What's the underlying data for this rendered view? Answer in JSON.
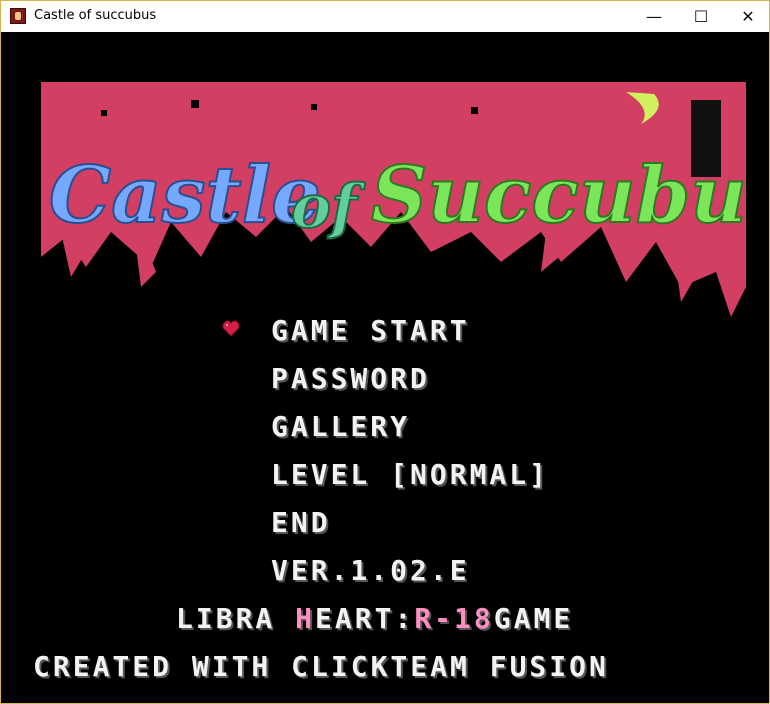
{
  "window": {
    "title": "Castle of succubus",
    "min_glyph": "—",
    "max_glyph": "☐",
    "close_glyph": "✕"
  },
  "logo": {
    "text": "Castle of Succubus"
  },
  "menu": {
    "items": [
      "GAME START",
      "PASSWORD",
      "GALLERY",
      "LEVEL [NORMAL]",
      "END",
      "VER.1.02.E"
    ],
    "selected": "GAME START"
  },
  "footer": {
    "credit_libra": "LIBRA ",
    "credit_h": "H",
    "credit_eart": "EART:",
    "credit_r18": "R-18",
    "credit_game": "GAME",
    "engine": "CREATED WITH CLICKTEAM FUSION"
  },
  "colors": {
    "logo_red": "#d23f63",
    "logo_blue": "#74a9ff",
    "logo_green": "#7be65a",
    "pink": "#ff8fc0",
    "text": "#f3f3f3"
  }
}
